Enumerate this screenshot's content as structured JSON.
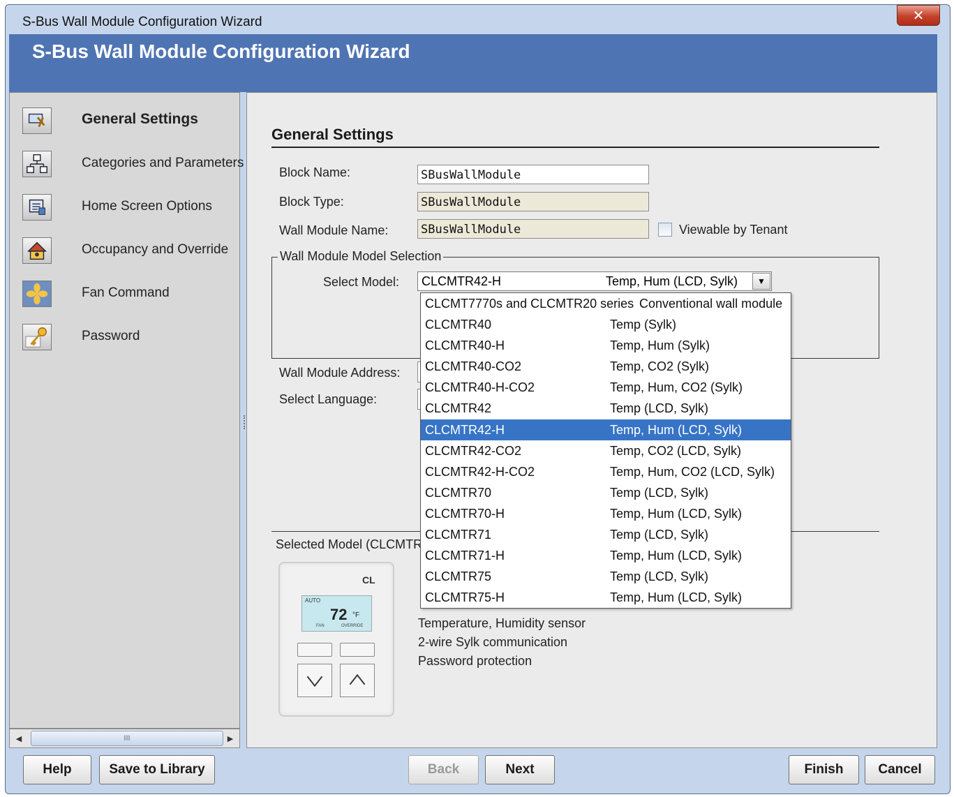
{
  "window": {
    "title": "S-Bus Wall Module Configuration Wizard",
    "close_label": "✕"
  },
  "banner": {
    "title": "S-Bus Wall Module Configuration Wizard"
  },
  "sidebar": {
    "items": [
      {
        "label": "General Settings",
        "icon": "settings-tools-icon",
        "active": true
      },
      {
        "label": "Categories and Parameters",
        "icon": "hierarchy-icon"
      },
      {
        "label": "Home Screen Options",
        "icon": "home-screen-icon"
      },
      {
        "label": "Occupancy and Override",
        "icon": "occupancy-house-icon"
      },
      {
        "label": "Fan Command",
        "icon": "fan-icon"
      },
      {
        "label": "Password",
        "icon": "key-icon"
      }
    ],
    "scroll_left": "◀",
    "scroll_right": "▶",
    "scroll_grip": "III"
  },
  "main": {
    "section_title": "General Settings",
    "block_name_label": "Block Name:",
    "block_name_value": "SBusWallModule",
    "block_type_label": "Block Type:",
    "block_type_value": "SBusWallModule",
    "wall_module_name_label": "Wall Module Name:",
    "wall_module_name_value": "SBusWallModule",
    "viewable_by_tenant_label": "Viewable by Tenant",
    "viewable_by_tenant_checked": false,
    "group_title": "Wall Module Model Selection",
    "select_model_label": "Select Model:",
    "selected_model": "CLCMTR42-H",
    "selected_model_desc": "Temp, Hum (LCD, Sylk)",
    "wall_module_address_label": "Wall Module Address:",
    "select_language_label": "Select Language:",
    "selected_model_caption": "Selected Model (CLCMTR",
    "features": [
      "Temperature, Humidity sensor",
      "2-wire Sylk communication",
      "Password protection"
    ],
    "device": {
      "brand": "CL",
      "lcd_mode": "AUTO",
      "lcd_temp": "72",
      "lcd_unit": "°F",
      "lcd_fan": "FAN",
      "lcd_override": "OVERRIDE"
    }
  },
  "dropdown": {
    "selected_index": 6,
    "options": [
      {
        "model": "CLCMT7770s and CLCMTR20 series",
        "desc": "Conventional wall module"
      },
      {
        "model": "CLCMTR40",
        "desc": "Temp (Sylk)"
      },
      {
        "model": "CLCMTR40-H",
        "desc": "Temp, Hum (Sylk)"
      },
      {
        "model": "CLCMTR40-CO2",
        "desc": "Temp, CO2 (Sylk)"
      },
      {
        "model": "CLCMTR40-H-CO2",
        "desc": "Temp, Hum, CO2 (Sylk)"
      },
      {
        "model": "CLCMTR42",
        "desc": "Temp (LCD, Sylk)"
      },
      {
        "model": "CLCMTR42-H",
        "desc": "Temp, Hum (LCD, Sylk)"
      },
      {
        "model": "CLCMTR42-CO2",
        "desc": "Temp, CO2 (LCD, Sylk)"
      },
      {
        "model": "CLCMTR42-H-CO2",
        "desc": "Temp, Hum, CO2 (LCD, Sylk)"
      },
      {
        "model": "CLCMTR70",
        "desc": "Temp (LCD, Sylk)"
      },
      {
        "model": "CLCMTR70-H",
        "desc": "Temp, Hum (LCD, Sylk)"
      },
      {
        "model": "CLCMTR71",
        "desc": "Temp (LCD, Sylk)"
      },
      {
        "model": "CLCMTR71-H",
        "desc": "Temp, Hum (LCD, Sylk)"
      },
      {
        "model": "CLCMTR75",
        "desc": "Temp (LCD, Sylk)"
      },
      {
        "model": "CLCMTR75-H",
        "desc": "Temp, Hum (LCD, Sylk)"
      }
    ]
  },
  "footer": {
    "help": "Help",
    "save_to_library": "Save to Library",
    "back": "Back",
    "next": "Next",
    "finish": "Finish",
    "cancel": "Cancel"
  },
  "colors": {
    "banner": "#4f74b3",
    "selection": "#3774c6",
    "content_bg": "#ebebeb",
    "sidebar_bg": "#d8d8d8"
  }
}
